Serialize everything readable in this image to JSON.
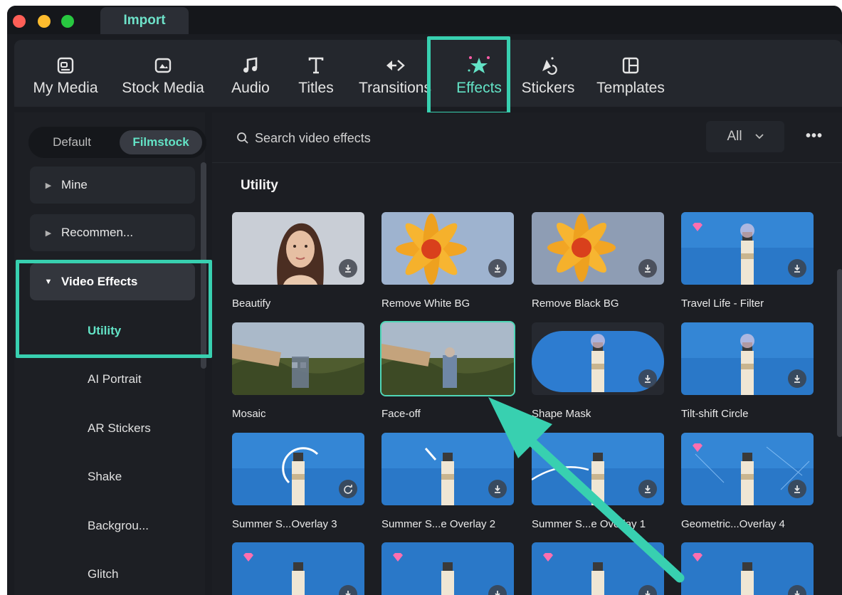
{
  "titlebar": {
    "import_tab": "Import"
  },
  "toolbar": {
    "items": [
      {
        "label": "My Media",
        "icon": "media-icon"
      },
      {
        "label": "Stock Media",
        "icon": "stock-media-icon"
      },
      {
        "label": "Audio",
        "icon": "music-note-icon"
      },
      {
        "label": "Titles",
        "icon": "text-t-icon"
      },
      {
        "label": "Transitions",
        "icon": "transition-arrows-icon"
      },
      {
        "label": "Effects",
        "icon": "sparkle-star-icon",
        "active": true
      },
      {
        "label": "Stickers",
        "icon": "sticker-icon"
      },
      {
        "label": "Templates",
        "icon": "template-grid-icon"
      }
    ]
  },
  "sidebar": {
    "segments": {
      "default": "Default",
      "filmstock": "Filmstock"
    },
    "categories": [
      {
        "label": "Mine"
      },
      {
        "label": "Recommen..."
      },
      {
        "label": "Video Effects",
        "expanded": true
      }
    ],
    "subitems": [
      "Utility",
      "AI Portrait",
      "AR Stickers",
      "Shake",
      "Backgrou...",
      "Glitch"
    ]
  },
  "search": {
    "placeholder": "Search video effects",
    "filter": "All",
    "more": "•••"
  },
  "section": {
    "title": "Utility"
  },
  "effects": [
    {
      "label": "Beautify"
    },
    {
      "label": "Remove White BG"
    },
    {
      "label": "Remove Black BG"
    },
    {
      "label": "Travel Life - Filter"
    },
    {
      "label": "Mosaic"
    },
    {
      "label": "Face-off"
    },
    {
      "label": "Shape Mask"
    },
    {
      "label": "Tilt-shift Circle"
    },
    {
      "label": "Summer S...Overlay 3"
    },
    {
      "label": "Summer S...e Overlay 2"
    },
    {
      "label": "Summer S...e Overlay 1"
    },
    {
      "label": "Geometric...Overlay 4"
    }
  ],
  "colors": {
    "accent": "#63e3c6",
    "highlight": "#38d0b0",
    "background": "#1a1c21"
  }
}
